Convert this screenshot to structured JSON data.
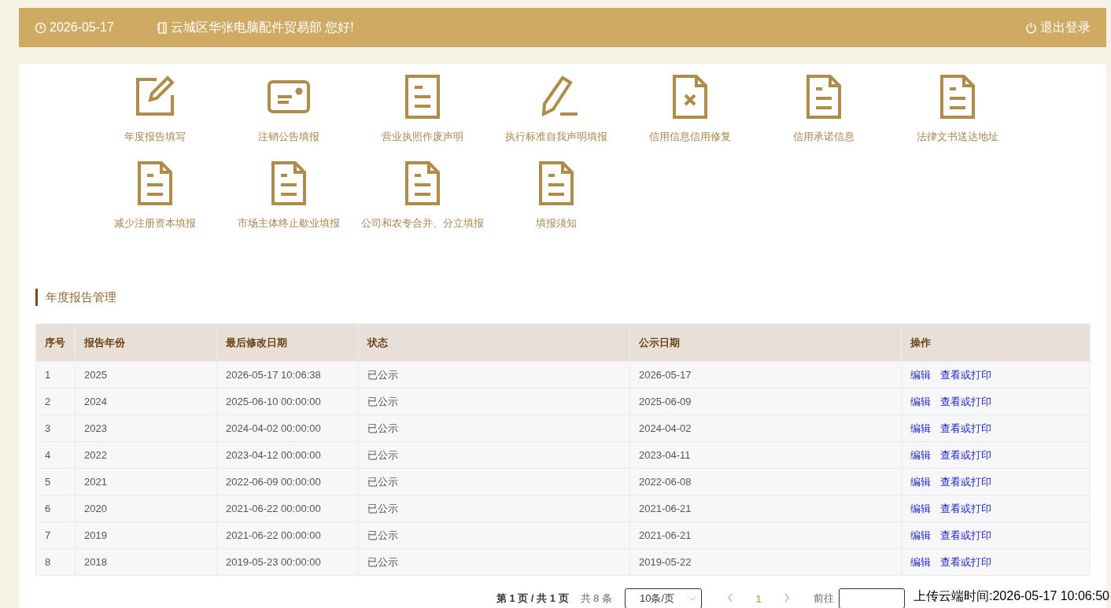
{
  "header": {
    "date": "2026-05-17",
    "greeting": "云城区华张电脑配件贸易部 您好!",
    "logout": "退出登录"
  },
  "shortcuts": [
    {
      "kind": "edit",
      "label": "年度报告填写"
    },
    {
      "kind": "card",
      "label": "注销公告填报"
    },
    {
      "kind": "doc",
      "label": "营业执照作废声明"
    },
    {
      "kind": "pencil",
      "label": "执行标准自我声明填报"
    },
    {
      "kind": "doc-x",
      "label": "信用信息信用修复"
    },
    {
      "kind": "doc-fold",
      "label": "信用承诺信息"
    },
    {
      "kind": "doc-fold",
      "label": "法律文书送达地址"
    },
    {
      "kind": "doc-fold",
      "label": "减少注册资本填报"
    },
    {
      "kind": "doc-fold",
      "label": "市场主体终止歇业填报"
    },
    {
      "kind": "doc-fold",
      "label": "公司和农专合并、分立填报"
    },
    {
      "kind": "doc-fold",
      "label": "填报须知"
    }
  ],
  "section_title": "年度报告管理",
  "table": {
    "columns": [
      "序号",
      "报告年份",
      "最后修改日期",
      "状态",
      "公示日期",
      "操作"
    ],
    "rows": [
      {
        "cells": [
          "1",
          "2025",
          "2026-05-17 10:06:38",
          "已公示",
          "2026-05-17"
        ],
        "actions": [
          "编辑",
          "查看或打印"
        ]
      },
      {
        "cells": [
          "2",
          "2024",
          "2025-06-10 00:00:00",
          "已公示",
          "2025-06-09"
        ],
        "actions": [
          "编辑",
          "查看或打印"
        ]
      },
      {
        "cells": [
          "3",
          "2023",
          "2024-04-02 00:00:00",
          "已公示",
          "2024-04-02"
        ],
        "actions": [
          "编辑",
          "查看或打印"
        ]
      },
      {
        "cells": [
          "4",
          "2022",
          "2023-04-12 00:00:00",
          "已公示",
          "2023-04-11"
        ],
        "actions": [
          "编辑",
          "查看或打印"
        ]
      },
      {
        "cells": [
          "5",
          "2021",
          "2022-06-09 00:00:00",
          "已公示",
          "2022-06-08"
        ],
        "actions": [
          "编辑",
          "查看或打印"
        ]
      },
      {
        "cells": [
          "6",
          "2020",
          "2021-06-22 00:00:00",
          "已公示",
          "2021-06-21"
        ],
        "actions": [
          "编辑",
          "查看或打印"
        ]
      },
      {
        "cells": [
          "7",
          "2019",
          "2021-06-22 00:00:00",
          "已公示",
          "2021-06-21"
        ],
        "actions": [
          "编辑",
          "查看或打印"
        ]
      },
      {
        "cells": [
          "8",
          "2018",
          "2019-05-23 00:00:00",
          "已公示",
          "2019-05-22"
        ],
        "actions": [
          "编辑",
          "查看或打印"
        ]
      }
    ]
  },
  "pagination": {
    "page_info": "第 1 页 / 共 1 页",
    "total": "共 8 条",
    "page_size": "10条/页",
    "pages": [
      {
        "label": "1",
        "selected": true
      }
    ],
    "goto_label": "前往"
  },
  "upload_time": "上传云端时间:2026-05-17 10:06:50"
}
